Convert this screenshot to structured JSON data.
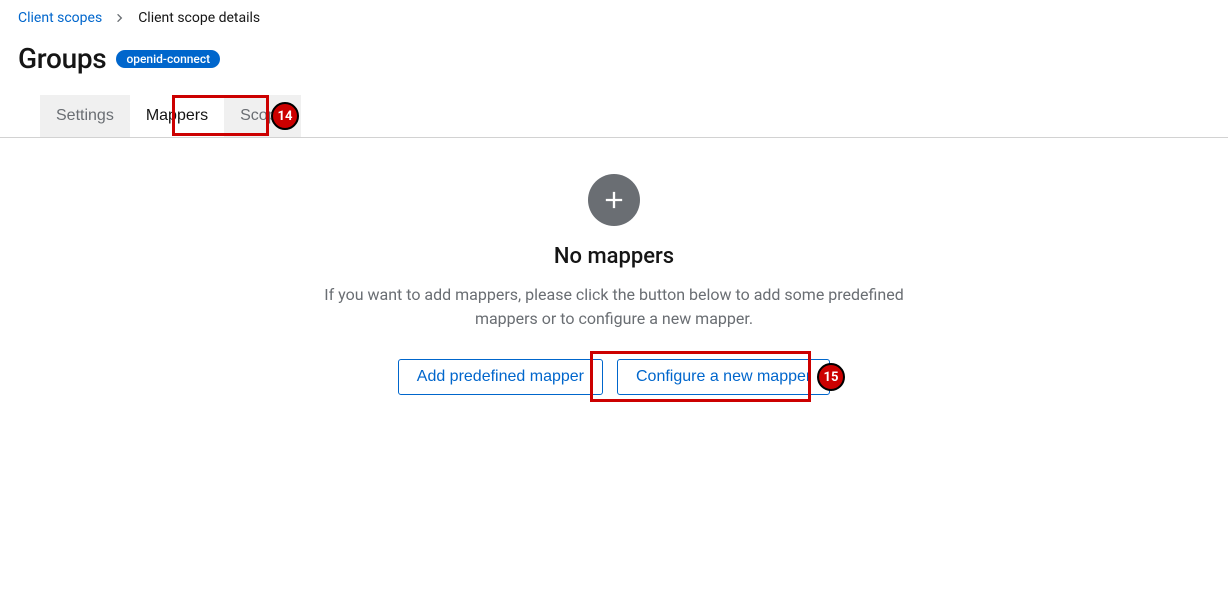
{
  "breadcrumb": {
    "root": "Client scopes",
    "current": "Client scope details"
  },
  "header": {
    "title": "Groups",
    "badge": "openid-connect"
  },
  "tabs": {
    "settings": "Settings",
    "mappers": "Mappers",
    "scope": "Scope"
  },
  "markers": {
    "tab": "14",
    "button": "15"
  },
  "empty": {
    "heading": "No mappers",
    "body": "If you want to add mappers, please click the button below to add some predefined mappers or to configure a new mapper.",
    "addPredefined": "Add predefined mapper",
    "configureNew": "Configure a new mapper"
  }
}
